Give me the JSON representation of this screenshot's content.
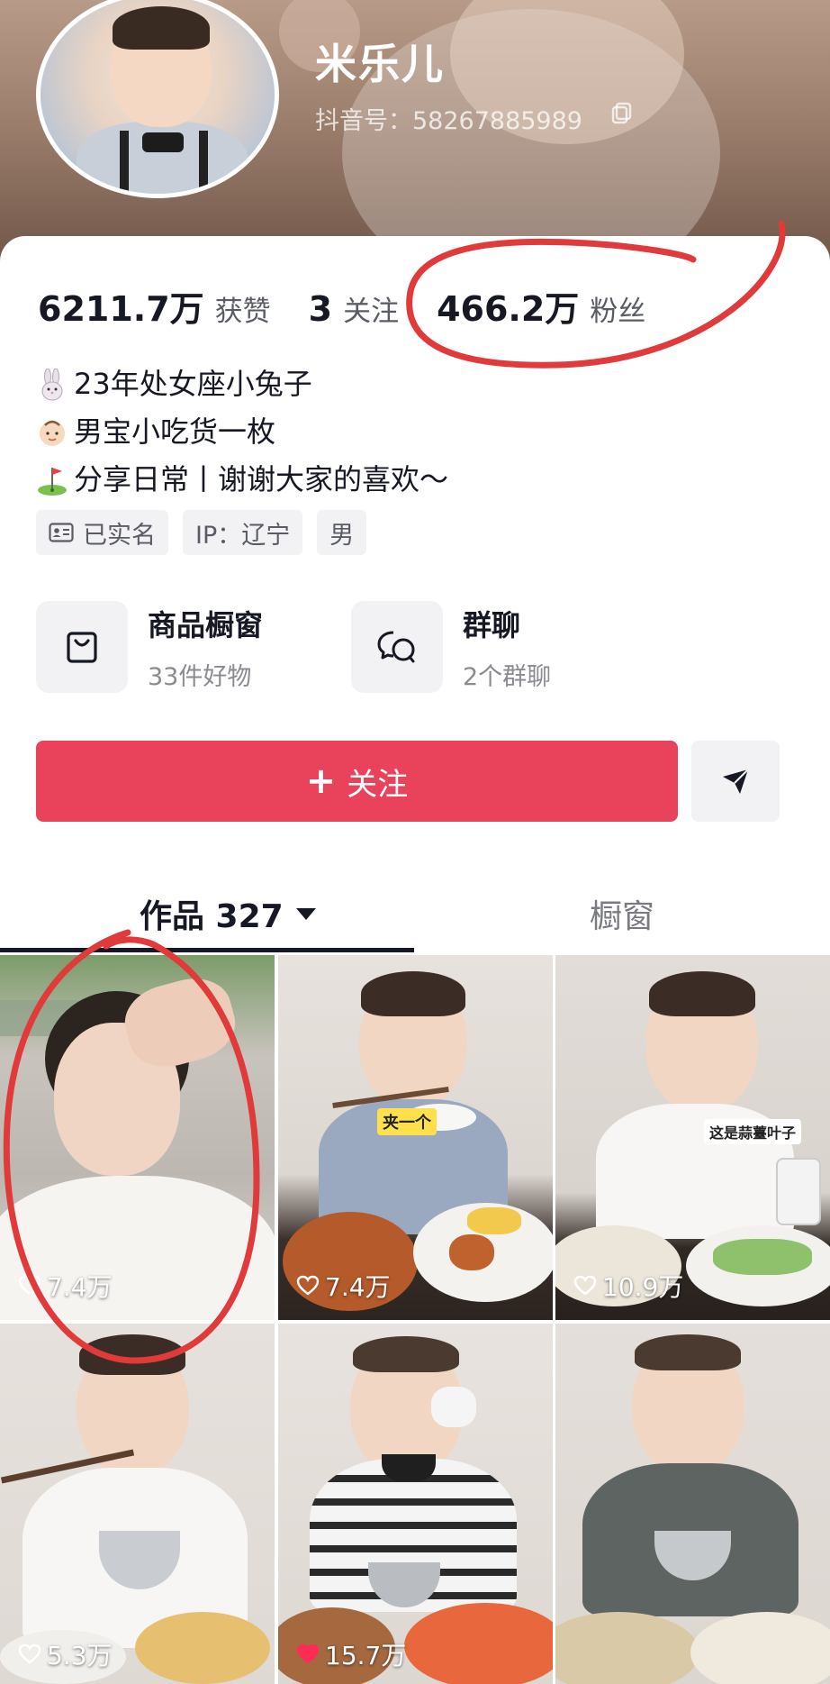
{
  "profile": {
    "nickname": "米乐儿",
    "douyin_id": "抖音号：58267885989"
  },
  "stats": [
    {
      "value": "6211.7万",
      "label": "获赞"
    },
    {
      "value": "3",
      "label": "关注"
    },
    {
      "value": "466.2万",
      "label": "粉丝"
    }
  ],
  "bio": [
    {
      "icon": "rabbit-emoji",
      "text": "23年处女座小兔子"
    },
    {
      "icon": "baby-emoji",
      "text": "男宝小吃货一枚"
    },
    {
      "icon": "golf-flag-emoji",
      "text": "分享日常丨谢谢大家的喜欢～"
    }
  ],
  "tags": [
    {
      "icon": "id-card-icon",
      "text": "已实名"
    },
    {
      "text": "IP：辽宁"
    },
    {
      "text": "男"
    }
  ],
  "features": [
    {
      "icon": "shopping-bag-icon",
      "title": "商品橱窗",
      "subtitle": "33件好物"
    },
    {
      "icon": "group-chat-icon",
      "title": "群聊",
      "subtitle": "2个群聊"
    }
  ],
  "actions": {
    "follow_label": "关注",
    "share_icon": "send-icon"
  },
  "tabs": {
    "works": "作品 327",
    "shop": "橱窗"
  },
  "videos": [
    {
      "likes": "7.4万",
      "liked": false
    },
    {
      "likes": "7.4万",
      "liked": false,
      "caption": "夹一个"
    },
    {
      "likes": "10.9万",
      "liked": false,
      "caption": "这是蒜薹叶子"
    },
    {
      "likes": "5.3万",
      "liked": false
    },
    {
      "likes": "15.7万",
      "liked": true
    },
    {
      "likes": "",
      "liked": false
    }
  ],
  "colors": {
    "follow_button": "#e8435b",
    "annotation": "#e03a3a"
  }
}
